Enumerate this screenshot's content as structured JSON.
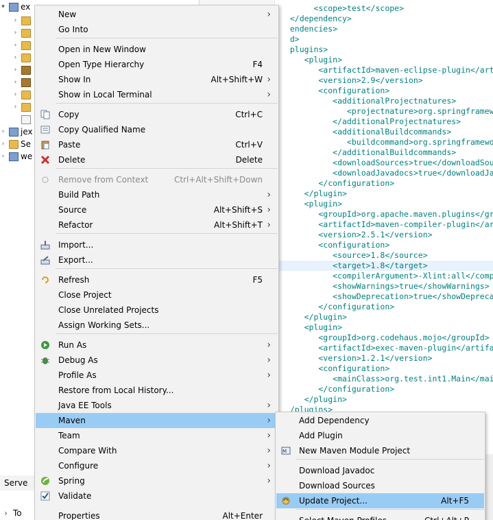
{
  "tree": {
    "rows": [
      {
        "label": "ex"
      },
      {
        "label": ""
      },
      {
        "label": ""
      },
      {
        "label": ""
      },
      {
        "label": ""
      },
      {
        "label": ""
      },
      {
        "label": ""
      },
      {
        "label": ""
      },
      {
        "label": ""
      },
      {
        "label": ""
      },
      {
        "label": "jex"
      },
      {
        "label": "Se"
      },
      {
        "label": "we"
      }
    ]
  },
  "bottom_views": {
    "servers_label": "Serve",
    "second_label": "To"
  },
  "editor": {
    "lines": [
      "       <scope>test</scope>",
      "  </dependency>",
      "  endencies>",
      "  d>",
      "  plugins>",
      "     <plugin>",
      "        <artifactId>maven-eclipse-plugin</arti",
      "        <version>2.9</version>",
      "        <configuration>",
      "           <additionalProjectnatures>",
      "              <projectnature>org.springframew",
      "           </additionalProjectnatures>",
      "           <additionalBuildcommands>",
      "              <buildcommand>org.springframewo",
      "           </additionalBuildcommands>",
      "           <downloadSources>true</downloadSou",
      "           <downloadJavadocs>true</downloadJa",
      "        </configuration>",
      "     </plugin>",
      "     <plugin>",
      "        <groupId>org.apache.maven.plugins</gro",
      "        <artifactId>maven-compiler-plugin</art",
      "        <version>2.5.1</version>",
      "        <configuration>",
      "           <source>1.8</source>",
      "           <target>1.8</target>",
      "           <compilerArgument>-Xlint:all</comp",
      "           <showWarnings>true</showWarnings>",
      "           <showDeprecation>true</showDeprecat",
      "        </configuration>",
      "     </plugin>",
      "     <plugin>",
      "        <groupId>org.codehaus.mojo</groupId>",
      "        <artifactId>exec-maven-plugin</artifac",
      "        <version>1.2.1</version>",
      "        <configuration>",
      "           <mainClass>org.test.int1.Main</mai",
      "        </configuration>",
      "     </plugin>",
      "  /plugins>"
    ]
  },
  "context_menu": {
    "items": [
      {
        "label": "New",
        "shortcut": "",
        "submenu": true,
        "icon": "",
        "disabled": false
      },
      {
        "label": "Go Into",
        "shortcut": "",
        "submenu": false,
        "icon": "",
        "disabled": false
      },
      {
        "label": "Open in New Window",
        "shortcut": "",
        "submenu": false,
        "icon": "",
        "disabled": false
      },
      {
        "label": "Open Type Hierarchy",
        "shortcut": "F4",
        "submenu": false,
        "icon": "",
        "disabled": false
      },
      {
        "label": "Show In",
        "shortcut": "Alt+Shift+W",
        "submenu": true,
        "icon": "",
        "disabled": false
      },
      {
        "label": "Show in Local Terminal",
        "shortcut": "",
        "submenu": true,
        "icon": "",
        "disabled": false
      },
      {
        "label": "Copy",
        "shortcut": "Ctrl+C",
        "submenu": false,
        "icon": "copy-icon",
        "disabled": false
      },
      {
        "label": "Copy Qualified Name",
        "shortcut": "",
        "submenu": false,
        "icon": "copy-qualified-icon",
        "disabled": false
      },
      {
        "label": "Paste",
        "shortcut": "Ctrl+V",
        "submenu": false,
        "icon": "paste-icon",
        "disabled": false
      },
      {
        "label": "Delete",
        "shortcut": "Delete",
        "submenu": false,
        "icon": "delete-icon",
        "disabled": false
      },
      {
        "label": "Remove from Context",
        "shortcut": "Ctrl+Alt+Shift+Down",
        "submenu": false,
        "icon": "remove-context-icon",
        "disabled": true
      },
      {
        "label": "Build Path",
        "shortcut": "",
        "submenu": true,
        "icon": "",
        "disabled": false
      },
      {
        "label": "Source",
        "shortcut": "Alt+Shift+S",
        "submenu": true,
        "icon": "",
        "disabled": false
      },
      {
        "label": "Refactor",
        "shortcut": "Alt+Shift+T",
        "submenu": true,
        "icon": "",
        "disabled": false
      },
      {
        "label": "Import...",
        "shortcut": "",
        "submenu": false,
        "icon": "import-icon",
        "disabled": false
      },
      {
        "label": "Export...",
        "shortcut": "",
        "submenu": false,
        "icon": "export-icon",
        "disabled": false
      },
      {
        "label": "Refresh",
        "shortcut": "F5",
        "submenu": false,
        "icon": "refresh-icon",
        "disabled": false
      },
      {
        "label": "Close Project",
        "shortcut": "",
        "submenu": false,
        "icon": "",
        "disabled": false
      },
      {
        "label": "Close Unrelated Projects",
        "shortcut": "",
        "submenu": false,
        "icon": "",
        "disabled": false
      },
      {
        "label": "Assign Working Sets...",
        "shortcut": "",
        "submenu": false,
        "icon": "",
        "disabled": false
      },
      {
        "label": "Run As",
        "shortcut": "",
        "submenu": true,
        "icon": "run-icon",
        "disabled": false
      },
      {
        "label": "Debug As",
        "shortcut": "",
        "submenu": true,
        "icon": "debug-icon",
        "disabled": false
      },
      {
        "label": "Profile As",
        "shortcut": "",
        "submenu": true,
        "icon": "",
        "disabled": false
      },
      {
        "label": "Restore from Local History...",
        "shortcut": "",
        "submenu": false,
        "icon": "",
        "disabled": false
      },
      {
        "label": "Java EE Tools",
        "shortcut": "",
        "submenu": true,
        "icon": "",
        "disabled": false
      },
      {
        "label": "Maven",
        "shortcut": "",
        "submenu": true,
        "icon": "",
        "disabled": false,
        "active": true
      },
      {
        "label": "Team",
        "shortcut": "",
        "submenu": true,
        "icon": "",
        "disabled": false
      },
      {
        "label": "Compare With",
        "shortcut": "",
        "submenu": true,
        "icon": "",
        "disabled": false
      },
      {
        "label": "Configure",
        "shortcut": "",
        "submenu": true,
        "icon": "",
        "disabled": false
      },
      {
        "label": "Spring",
        "shortcut": "",
        "submenu": true,
        "icon": "spring-icon",
        "disabled": false
      },
      {
        "label": "Validate",
        "shortcut": "",
        "submenu": false,
        "icon": "checkbox-icon",
        "disabled": false
      },
      {
        "label": "Properties",
        "shortcut": "Alt+Enter",
        "submenu": false,
        "icon": "",
        "disabled": false
      }
    ]
  },
  "maven_submenu": {
    "items": [
      {
        "label": "Add Dependency",
        "shortcut": "",
        "icon": ""
      },
      {
        "label": "Add Plugin",
        "shortcut": "",
        "icon": ""
      },
      {
        "label": "New Maven Module Project",
        "shortcut": "",
        "icon": "maven-module-icon"
      },
      {
        "label": "Download Javadoc",
        "shortcut": "",
        "icon": ""
      },
      {
        "label": "Download Sources",
        "shortcut": "",
        "icon": ""
      },
      {
        "label": "Update Project...",
        "shortcut": "Alt+F5",
        "icon": "update-project-icon",
        "active": true
      },
      {
        "label": "Select Maven Profiles...",
        "shortcut": "Ctrl+Alt+P",
        "icon": ""
      }
    ]
  },
  "colors": {
    "menu_bg": "#f2f2f2",
    "highlight": "#99ccf5",
    "xml_tag": "#008080",
    "xml_text": "#000000"
  }
}
